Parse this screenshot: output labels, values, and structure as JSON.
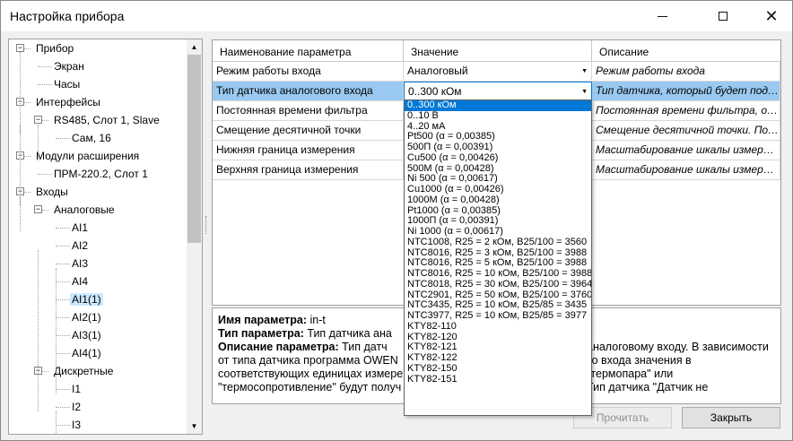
{
  "window": {
    "title": "Настройка прибора"
  },
  "tree": {
    "items": [
      {
        "label": "Прибор",
        "level": 0,
        "expander": "−"
      },
      {
        "label": "Экран",
        "level": 1
      },
      {
        "label": "Часы",
        "level": 1
      },
      {
        "label": "Интерфейсы",
        "level": 0,
        "expander": "−"
      },
      {
        "label": "RS485, Слот 1, Slave",
        "level": 1,
        "expander": "−"
      },
      {
        "label": "Сам, 16",
        "level": 2
      },
      {
        "label": "Модули расширения",
        "level": 0,
        "expander": "−"
      },
      {
        "label": "ПРМ-220.2, Слот 1",
        "level": 1
      },
      {
        "label": "Входы",
        "level": 0,
        "expander": "−"
      },
      {
        "label": "Аналоговые",
        "level": 1,
        "expander": "−"
      },
      {
        "label": "AI1",
        "level": 2
      },
      {
        "label": "AI2",
        "level": 2
      },
      {
        "label": "AI3",
        "level": 2
      },
      {
        "label": "AI4",
        "level": 2
      },
      {
        "label": "AI1(1)",
        "level": 2,
        "selected": true
      },
      {
        "label": "AI2(1)",
        "level": 2
      },
      {
        "label": "AI3(1)",
        "level": 2
      },
      {
        "label": "AI4(1)",
        "level": 2
      },
      {
        "label": "Дискретные",
        "level": 1,
        "expander": "−"
      },
      {
        "label": "I1",
        "level": 2
      },
      {
        "label": "I2",
        "level": 2
      },
      {
        "label": "I3",
        "level": 2
      }
    ]
  },
  "grid": {
    "headers": [
      "Наименование параметра",
      "Значение",
      "Описание"
    ],
    "rows": [
      {
        "name": "Режим работы входа",
        "value": "Аналоговый",
        "desc": "Режим работы входа"
      },
      {
        "name": "Тип датчика аналогового входа",
        "value": "0..300 кОм",
        "desc": "Тип датчика, который будет подключё..."
      },
      {
        "name": "Постоянная времени фильтра",
        "value": "",
        "desc": "Постоянная времени фильтра, от 0 до..."
      },
      {
        "name": "Смещение десятичной точки",
        "value": "",
        "desc": "Смещение десятичной точки. Поле пр..."
      },
      {
        "name": "Нижняя граница измерения",
        "value": "",
        "desc": "Масштабирование шкалы измерения...."
      },
      {
        "name": "Верхняя граница измерения",
        "value": "",
        "desc": "Масштабирование шкалы измерения...."
      }
    ]
  },
  "dropdown": {
    "selected": "0..300 кОм",
    "options": [
      "0..300 кОм",
      "0..10 В",
      "4..20 мА",
      "Pt500 (α = 0,00385)",
      "500П (α = 0,00391)",
      "Cu500 (α = 0,00426)",
      "500М (α = 0,00428)",
      "Ni 500 (α = 0,00617)",
      "Cu1000 (α = 0,00426)",
      "1000М (α = 0,00428)",
      "Pt1000 (α = 0,00385)",
      "1000П (α = 0,00391)",
      "Ni 1000 (α = 0,00617)",
      "NTC1008, R25 = 2 кОм, B25/100 = 3560",
      "NTC8016, R25 = 3 кОм, B25/100 = 3988",
      "NTC8016, R25 = 5 кОм, B25/100 = 3988",
      "NTC8016, R25 = 10 кОм, B25/100 = 3988",
      "NTC8018, R25 = 30 кОм, B25/100 = 3964",
      "NTC2901, R25 = 50 кОм, B25/100 = 3760",
      "NTC3435, R25 = 10 кОм, B25/85 = 3435",
      "NTC3977, R25 = 10 кОм, B25/85 = 3977",
      "KTY82-110",
      "KTY82-120",
      "KTY82-121",
      "KTY82-122",
      "KTY82-150",
      "KTY82-151"
    ]
  },
  "info": {
    "name_label": "Имя параметра:",
    "name_value": "in-t",
    "type_label": "Тип параметра:",
    "type_value": "Тип датчика ана",
    "desc_label": "Описание параметра:",
    "desc_line1_a": "Тип датч",
    "desc_line1_b": "аналоговому входу. В зависимости",
    "desc_line2_a": "от типа датчика программа OWEN",
    "desc_line2_b": "то входа значения в",
    "desc_line3_a": "соответствующих единицах измере",
    "desc_line3_b": "\"термопара\" или",
    "desc_line4_a": "\"термосопротивление\" будут получ",
    "desc_line4_b": "Тип датчика \"Датчик не"
  },
  "buttons": {
    "apply": "Прочитать",
    "close": "Закрыть"
  }
}
